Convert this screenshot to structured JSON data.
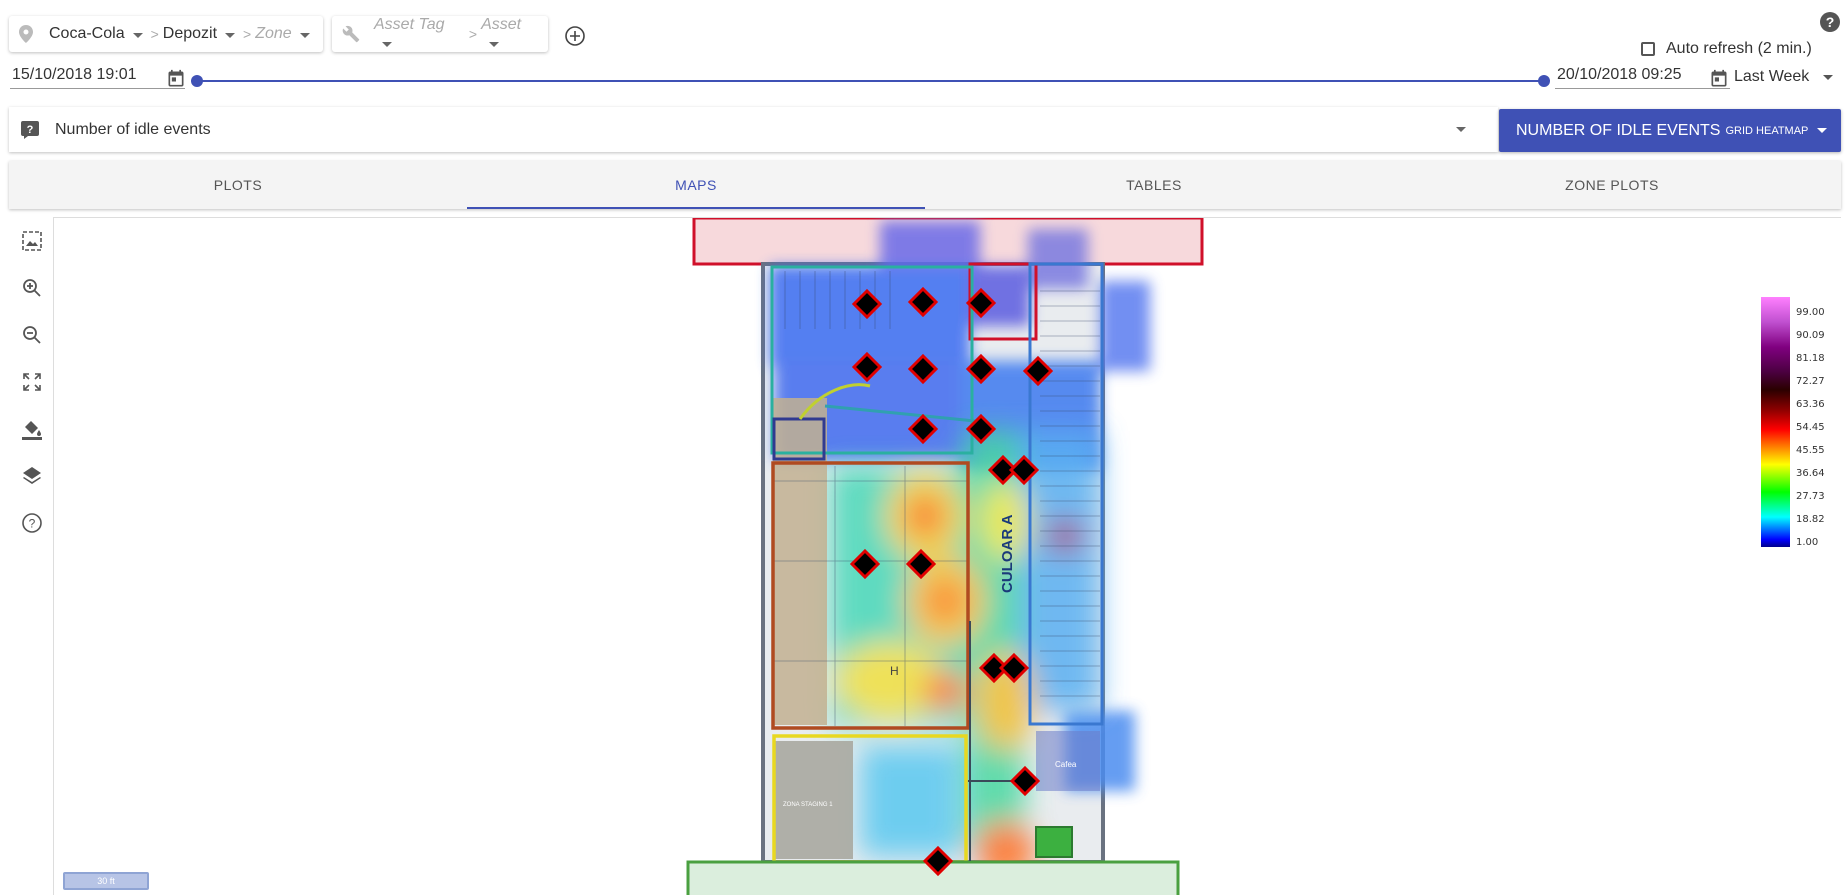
{
  "filters": {
    "company": "Coca-Cola",
    "location": "Depozit",
    "zone_placeholder": "Zone",
    "asset_tag_placeholder": "Asset Tag",
    "asset_placeholder": "Asset"
  },
  "auto_refresh_label": "Auto refresh (2 min.)",
  "time": {
    "start": "15/10/2018 19:01",
    "end": "20/10/2018 09:25",
    "preset": "Last Week",
    "slider_start_fraction": 0,
    "slider_end_fraction": 1
  },
  "metric": {
    "select_value": "Number of idle events",
    "button_label": "NUMBER OF IDLE EVENTS",
    "button_sub": "GRID HEATMAP"
  },
  "tabs": [
    {
      "label": "PLOTS",
      "active": false
    },
    {
      "label": "MAPS",
      "active": true
    },
    {
      "label": "TABLES",
      "active": false
    },
    {
      "label": "ZONE PLOTS",
      "active": false
    }
  ],
  "map_tools": [
    "fit-view-icon",
    "zoom-in-icon",
    "zoom-out-icon",
    "fullscreen-icon",
    "paint-bucket-icon",
    "layers-icon",
    "help-icon"
  ],
  "legend_ticks": [
    "99.00",
    "90.09",
    "81.18",
    "72.27",
    "63.36",
    "54.45",
    "45.55",
    "36.64",
    "27.73",
    "18.82",
    "1.00"
  ],
  "scale_label": "30 ft",
  "map_labels": {
    "aisle": "CULOAR  A",
    "hall": "H",
    "room": "Cafea",
    "stage": "ZONA STAGING 1"
  },
  "colors": {
    "accent": "#3f51b5",
    "marker": "#e00000"
  }
}
